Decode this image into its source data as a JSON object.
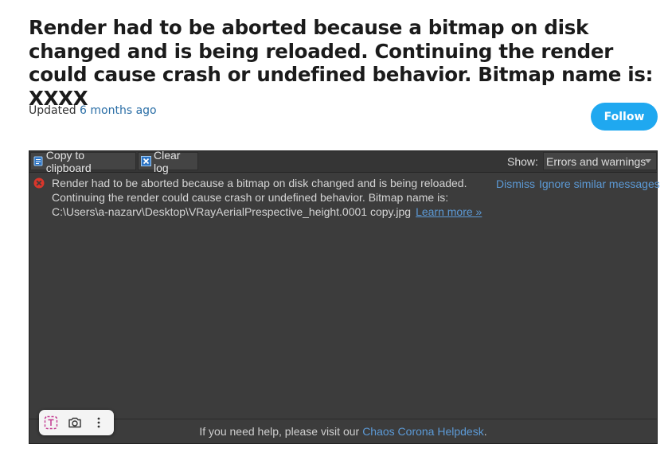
{
  "article": {
    "title": "Render had to be aborted because a bitmap on disk changed and is being reloaded. Continuing the render could cause crash or undefined behavior. Bitmap name is: XXXX",
    "updated_prefix": "Updated",
    "updated_ago": "6 months ago",
    "follow_label": "Follow"
  },
  "log_window": {
    "toolbar": {
      "copy_label": "Copy to clipboard",
      "clear_label": "Clear log",
      "show_label": "Show:",
      "show_value": "Errors and warnings"
    },
    "message": {
      "text": "Render had to be aborted because a bitmap on disk changed and is being reloaded. Continuing the render could cause crash or undefined behavior. Bitmap name is: C:\\Users\\a-nazarv\\Desktop\\VRayAerialPrespective_height.0001 copy.jpg",
      "learn_more": "Learn more »",
      "dismiss": "Dismiss",
      "ignore": "Ignore similar messages"
    },
    "footer": {
      "text": "If you need help, please visit our",
      "link": "Chaos Corona Helpdesk",
      "end": "."
    }
  },
  "overlay_toolbar": {
    "items": [
      "text-select-icon",
      "camera-icon",
      "more-icon"
    ]
  },
  "colors": {
    "follow": "#1fa8f0",
    "panel_bg": "#3c3c3c",
    "link": "#5c9ad6",
    "error": "#d9362b"
  }
}
